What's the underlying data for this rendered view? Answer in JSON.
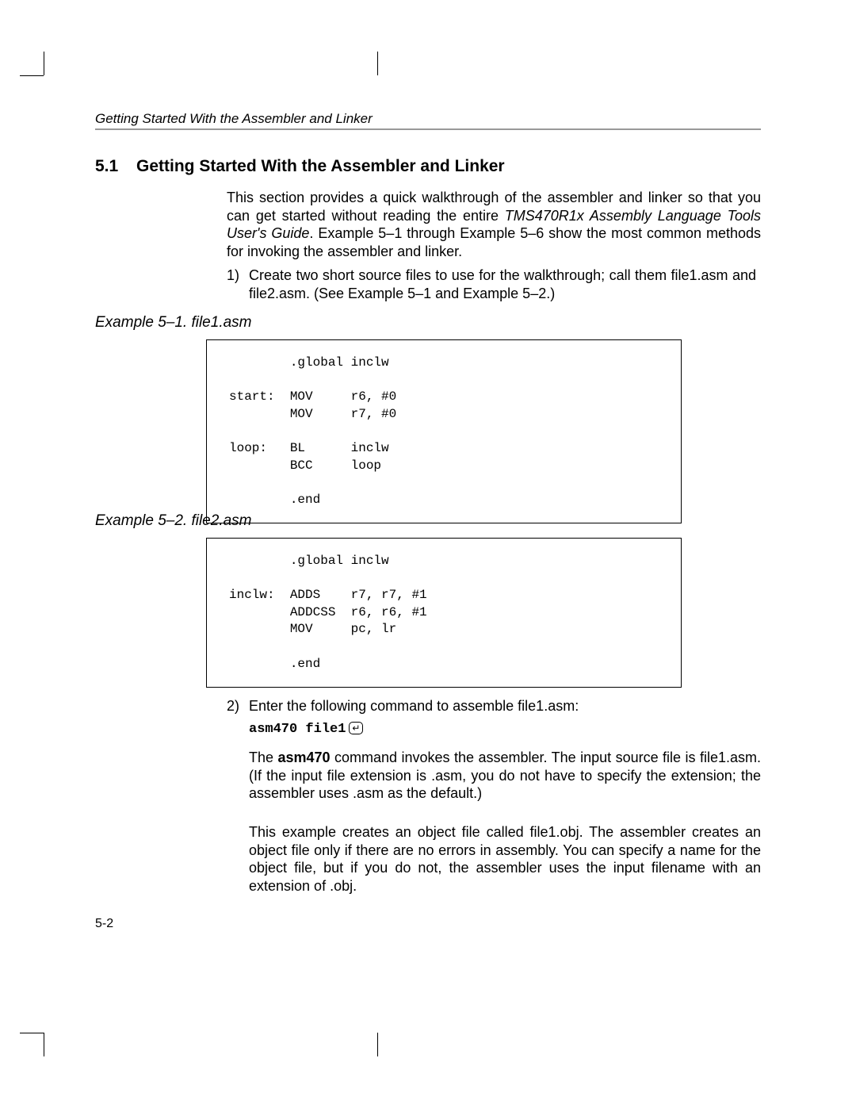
{
  "header": {
    "running": "Getting Started With the Assembler and Linker"
  },
  "section": {
    "num": "5.1",
    "title": "Getting Started With the Assembler and Linker"
  },
  "intro": {
    "p1a": "This section provides a quick walkthrough of the assembler and linker so that you can get started without reading the entire ",
    "p1b": "TMS470R1x Assembly Language Tools User's Guide",
    "p1c": ". Example 5–1 through Example 5–6 show the most common methods for invoking the assembler and linker."
  },
  "step1": {
    "num": "1)",
    "text": "Create two short source files to use for the walkthrough; call them file1.asm and file2.asm. (See Example 5–1 and Example 5–2.)"
  },
  "ex1": {
    "label": "Example 5–1. file1.asm",
    "code": "        .global inclw\n\nstart:  MOV     r6, #0\n        MOV     r7, #0\n\nloop:   BL      inclw\n        BCC     loop\n\n        .end"
  },
  "ex2": {
    "label": "Example 5–2. file2.asm",
    "code": "        .global inclw\n\ninclw:  ADDS    r7, r7, #1\n        ADDCSS  r6, r6, #1\n        MOV     pc, lr\n\n        .end"
  },
  "step2": {
    "num": "2)",
    "lead": "Enter the following command to assemble file1.asm:",
    "cmd": "asm470 file1",
    "enter": "↵",
    "p2a": "The ",
    "p2b": "asm470",
    "p2c": " command invokes the assembler. The input source file is file1.asm. (If the input file extension is .asm, you do not have to specify the extension; the assembler uses .asm as the default.)",
    "p3": "This example creates an object file called file1.obj. The assembler creates an object file only if there are no errors in assembly. You can specify a name for the object file, but if you do not, the assembler uses the input filename with an extension of .obj."
  },
  "footer": {
    "page": "5-2"
  }
}
